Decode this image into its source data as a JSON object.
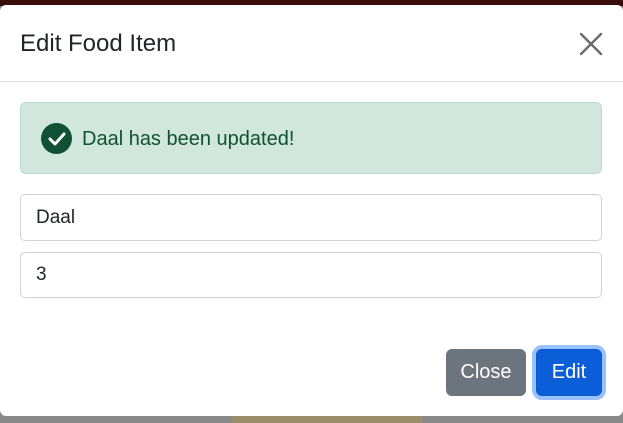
{
  "modal": {
    "title": "Edit Food Item",
    "close_icon": "close-x-icon"
  },
  "alert": {
    "icon": "check-circle-icon",
    "message": "Daal has been updated!",
    "color": "#0f5132",
    "background": "#d1e7dd"
  },
  "form": {
    "name_value": "Daal",
    "quantity_value": "3"
  },
  "footer": {
    "close_label": "Close",
    "edit_label": "Edit",
    "close_color": "#6c757d",
    "edit_color": "#0b5ed7"
  }
}
